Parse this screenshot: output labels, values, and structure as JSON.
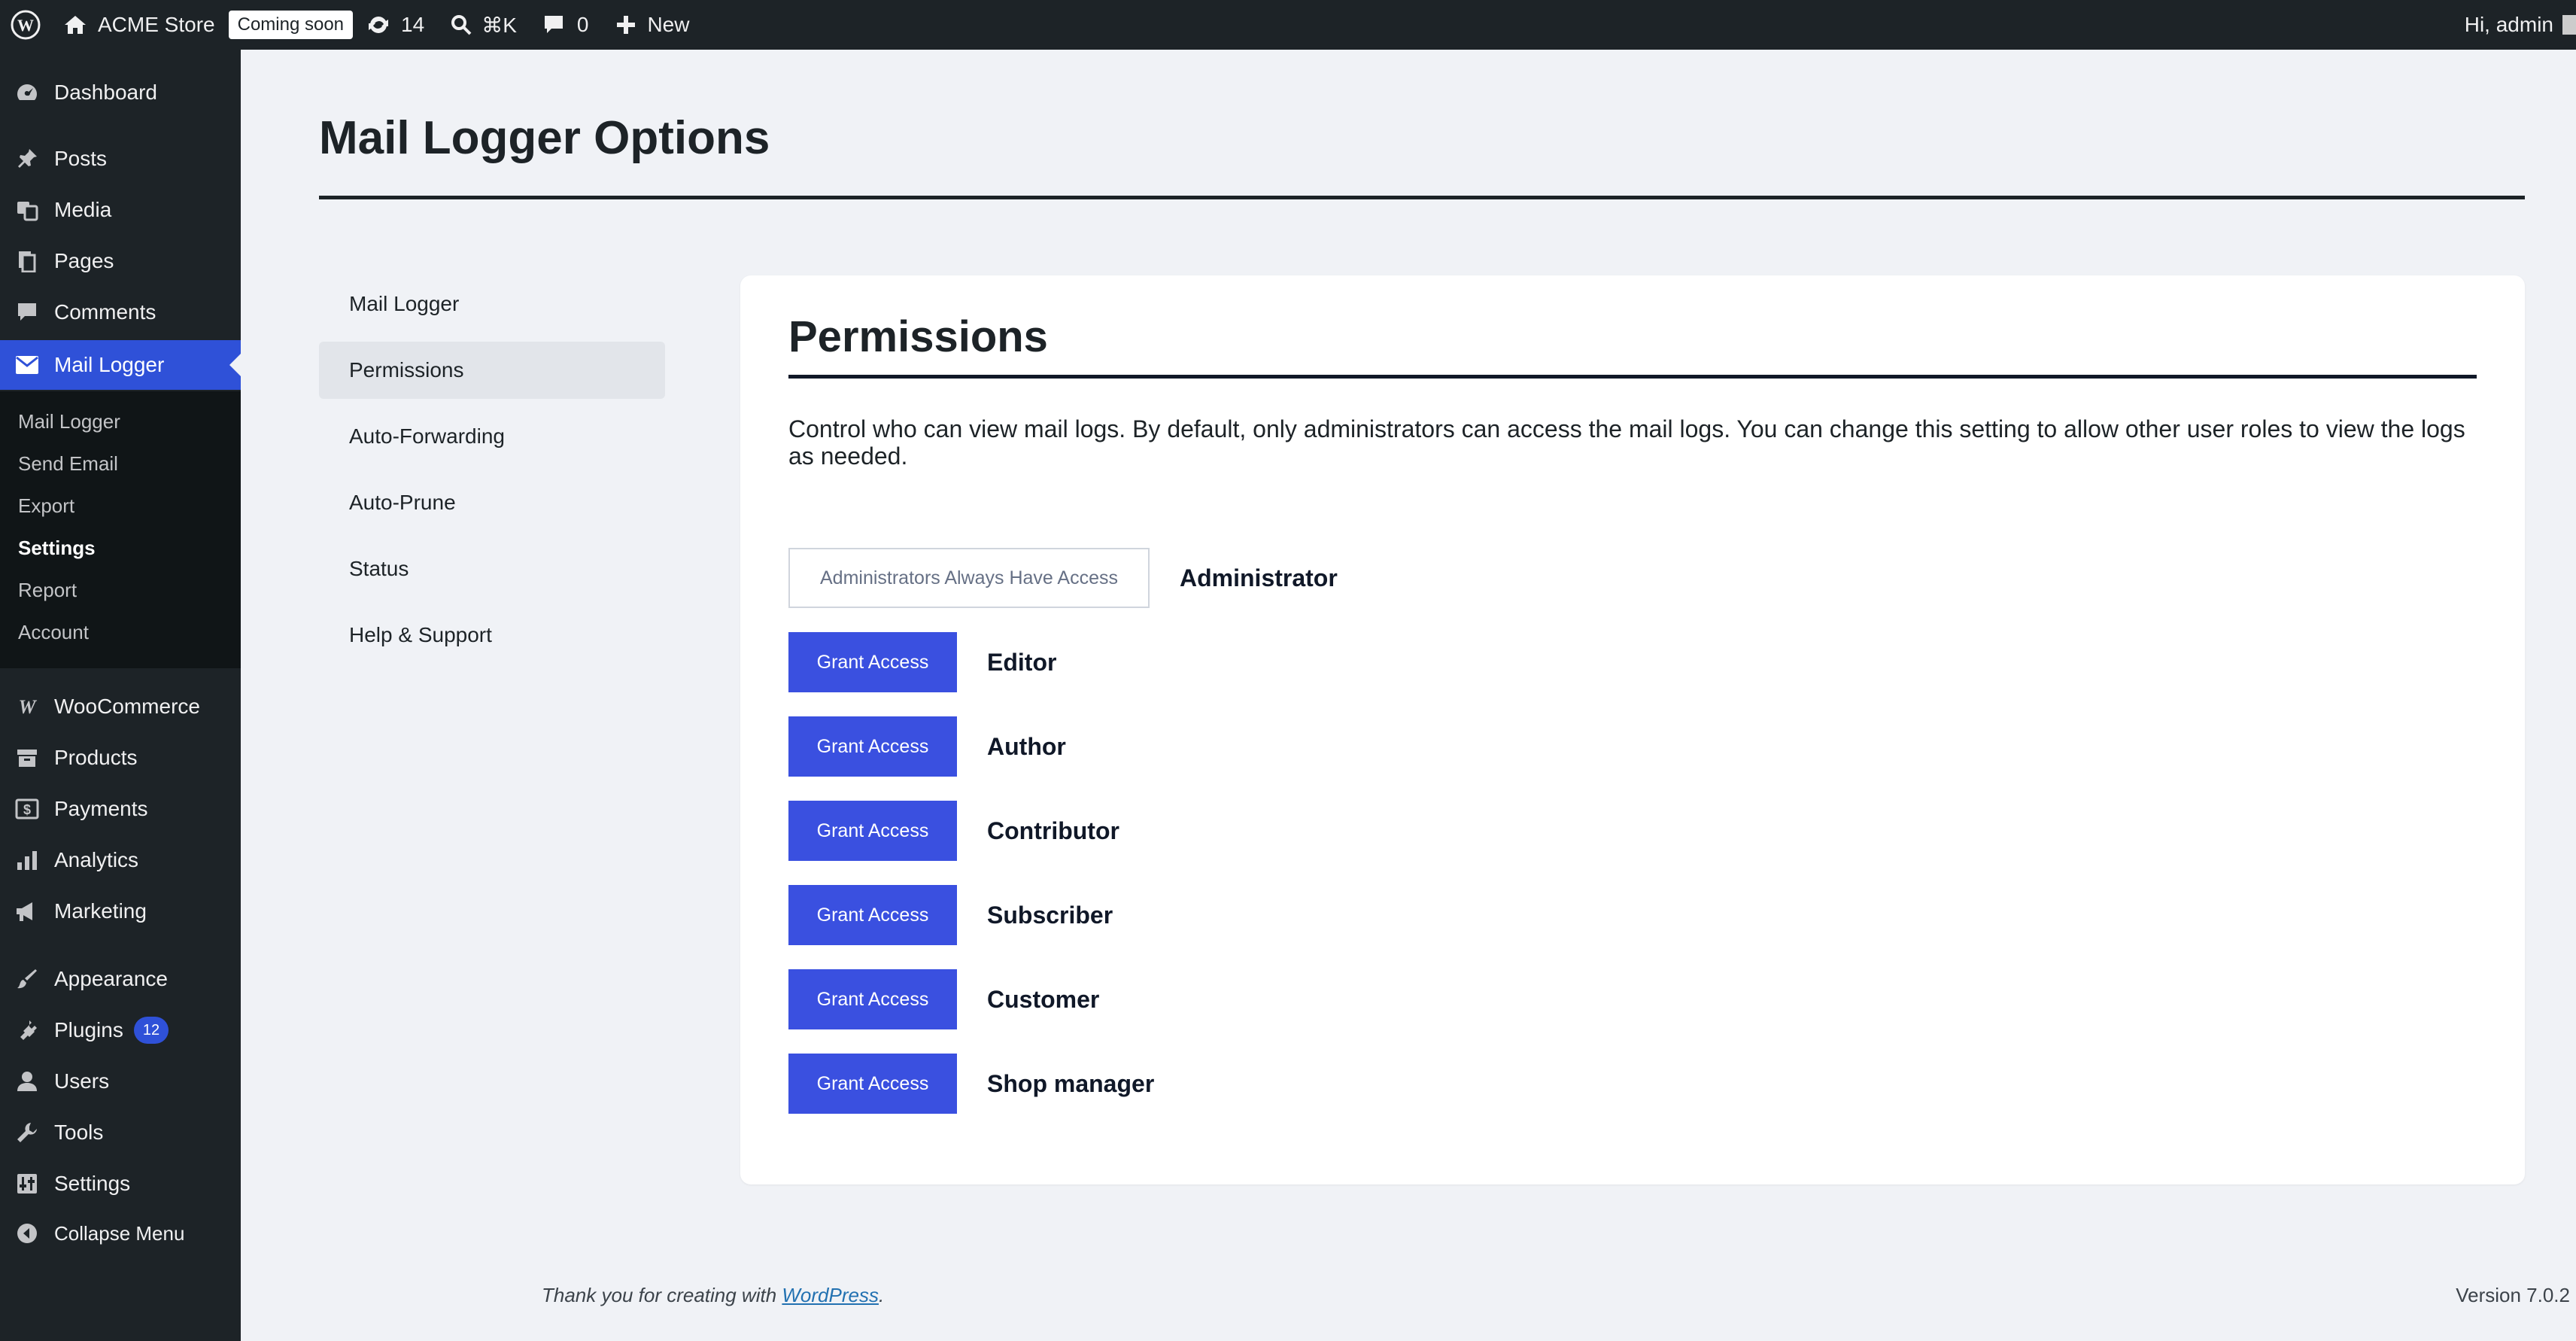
{
  "adminbar": {
    "site_name": "ACME Store",
    "coming_soon": "Coming soon",
    "updates_count": "14",
    "search_shortcut": "⌘K",
    "comments_count": "0",
    "new_label": "New",
    "greeting": "Hi, admin"
  },
  "sidebar": {
    "items": [
      {
        "label": "Dashboard",
        "icon": "dashboard-icon"
      },
      {
        "label": "Posts",
        "icon": "pin-icon"
      },
      {
        "label": "Media",
        "icon": "media-icon"
      },
      {
        "label": "Pages",
        "icon": "pages-icon"
      },
      {
        "label": "Comments",
        "icon": "comment-icon"
      },
      {
        "label": "Mail Logger",
        "icon": "envelope-icon"
      },
      {
        "label": "WooCommerce",
        "icon": "woocommerce-icon"
      },
      {
        "label": "Products",
        "icon": "archive-icon"
      },
      {
        "label": "Payments",
        "icon": "payments-icon"
      },
      {
        "label": "Analytics",
        "icon": "bar-chart-icon"
      },
      {
        "label": "Marketing",
        "icon": "megaphone-icon"
      },
      {
        "label": "Appearance",
        "icon": "brush-icon"
      },
      {
        "label": "Plugins",
        "icon": "plugin-icon",
        "badge": "12"
      },
      {
        "label": "Users",
        "icon": "user-icon"
      },
      {
        "label": "Tools",
        "icon": "wrench-icon"
      },
      {
        "label": "Settings",
        "icon": "settings-icon"
      },
      {
        "label": "Collapse Menu",
        "icon": "collapse-icon"
      }
    ],
    "submenu": [
      "Mail Logger",
      "Send Email",
      "Export",
      "Settings",
      "Report",
      "Account"
    ]
  },
  "page": {
    "title": "Mail Logger Options"
  },
  "subnav": [
    "Mail Logger",
    "Permissions",
    "Auto-Forwarding",
    "Auto-Prune",
    "Status",
    "Help & Support"
  ],
  "permissions": {
    "title": "Permissions",
    "description": "Control who can view mail logs. By default, only administrators can access the mail logs. You can change this setting to allow other user roles to view the logs as needed.",
    "admin_button": "Administrators Always Have Access",
    "grant_label": "Grant Access",
    "roles": [
      "Administrator",
      "Editor",
      "Author",
      "Contributor",
      "Subscriber",
      "Customer",
      "Shop manager"
    ]
  },
  "footer": {
    "thanks_prefix": "Thank you for creating with ",
    "link_text": "WordPress",
    "thanks_suffix": ".",
    "version": "Version 7.0.2"
  },
  "colors": {
    "accent": "#3a50e0",
    "sidebar_bg": "#1d2327",
    "current_menu": "#2f51d8"
  }
}
